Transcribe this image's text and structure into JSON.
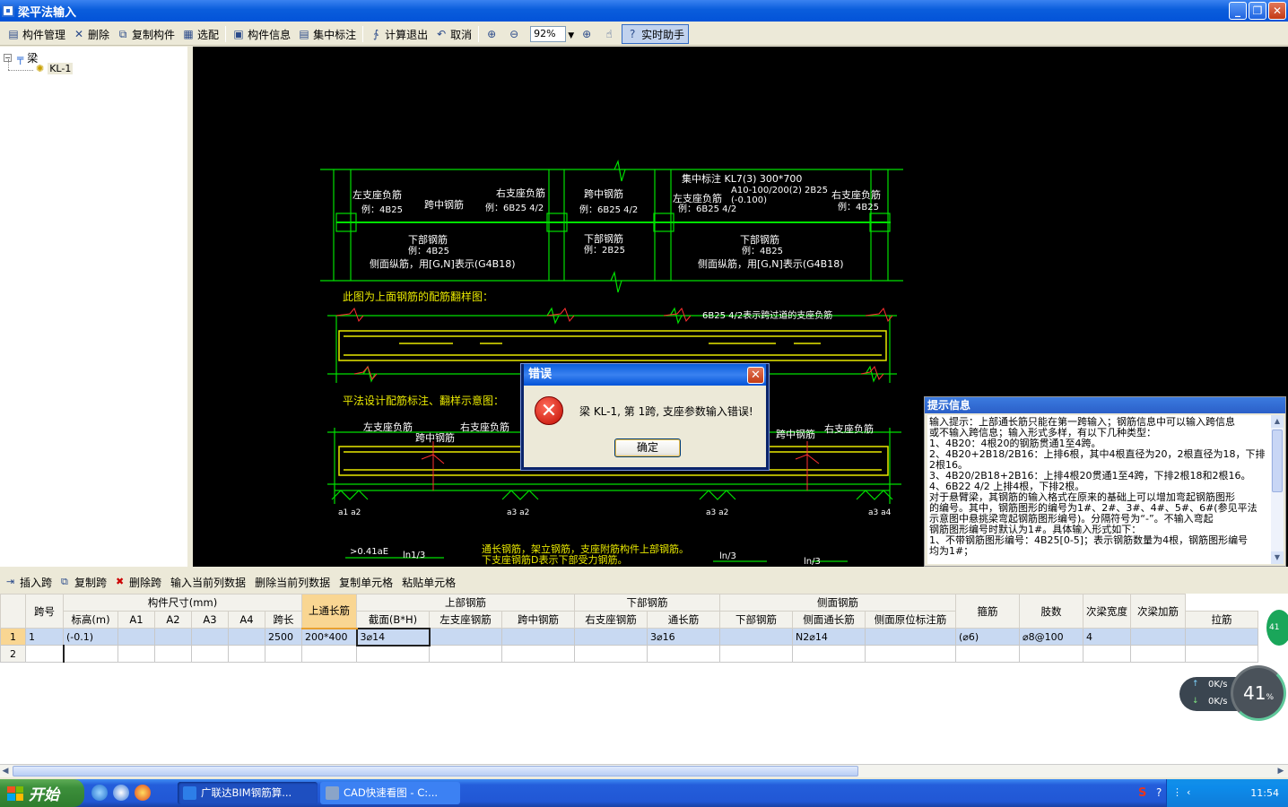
{
  "window": {
    "title": "梁平法输入"
  },
  "toolbar": {
    "items": [
      "构件管理",
      "删除",
      "复制构件",
      "选配",
      "构件信息",
      "集中标注",
      "计算退出",
      "取消"
    ],
    "zoom": "92%",
    "assistant": "实时助手"
  },
  "tree": {
    "root": "梁",
    "child": "KL-1"
  },
  "drawing": {
    "jz_title": "集中标注 KL7(3) 300*700",
    "jz_line2": "A10-100/200(2) 2B25",
    "jz_line3": "(-0.100)",
    "zuo_fu": "左支座负筋",
    "zuo_fu_eg": "例：4B25",
    "kua_zhong": "跨中钢筋",
    "you_fu": "右支座负筋",
    "you_fu_eg": "例：6B25 4/2",
    "kua_zhong2": "跨中钢筋",
    "kz_eg": "例：6B25 4/2",
    "zuo_fu2": "左支座负筋",
    "zuo_fu2_eg": "例：6B25 4/2",
    "you_fu2": "右支座负筋",
    "you_fu2_eg": "例：4B25",
    "xia1": "下部钢筋",
    "xia1_eg": "例：4B25",
    "xia2": "下部钢筋",
    "xia2_eg": "例：2B25",
    "xia3": "下部钢筋",
    "xia3_eg": "例：4B25",
    "cemian1": "侧面纵筋，用[G,N]表示(G4B18)",
    "cemian2": "侧面纵筋，用[G,N]表示(G4B18)",
    "caption1": "此图为上面钢筋的配筋翻样图：",
    "note_6b25": "6B25 4/2表示跨过道的支座负筋",
    "caption2": "平法设计配筋标注、翻样示意图：",
    "b_zuo": "左支座负筋",
    "b_you": "右支座负筋",
    "b_kz": "跨中钢筋",
    "b_kz2": "跨中钢筋",
    "b_you2": "右支座负筋",
    "a1a2": "a1  a2",
    "a3a2": "a3  a2",
    "a3a2b": "a3  a2",
    "a3a4": "a3  a4",
    "len1": ">0.41aE",
    "ln13": "ln1/3",
    "ln3": "ln/3",
    "ln3b": "ln/3",
    "foot1": "通长钢筋，架立钢筋，支座附筋构件上部钢筋。",
    "foot2": "下支座钢筋D表示下部受力钢筋。"
  },
  "tips": {
    "title": "提示信息",
    "lines": [
      "输入提示：上部通长筋只能在第一跨输入；钢筋信息中可以输入跨信息",
      "或不输入跨信息；输入形式多样，有以下几种类型：",
      "1、4B20：4根20的钢筋贯通1至4跨。",
      "2、4B20+2B18/2B16：上排6根，其中4根直径为20，2根直径为18，下排",
      "2根16。",
      "3、4B20/2B18+2B16：上排4根20贯通1至4跨，下排2根18和2根16。",
      "4、6B22 4/2 上排4根，下排2根。",
      "对于悬臂梁，其钢筋的输入格式在原来的基础上可以增加弯起钢筋图形",
      "的编号。其中，钢筋图形的编号为1#、2#、3#、4#、5#、6#(参见平法",
      "示意图中悬挑梁弯起钢筋图形编号)。分隔符号为“-”。不输入弯起",
      "钢筋图形编号时默认为1#。具体输入形式如下：",
      "1、不带钢筋图形编号：4B25[0-5]；表示钢筋数量为4根，钢筋图形编号",
      "均为1#；"
    ]
  },
  "dialog": {
    "title": "错误",
    "message": "梁 KL-1, 第 1跨, 支座参数输入错误!",
    "ok": "确定"
  },
  "gridbar": {
    "items": [
      "插入跨",
      "复制跨",
      "删除跨",
      "输入当前列数据",
      "删除当前列数据",
      "复制单元格",
      "粘贴单元格"
    ]
  },
  "grid": {
    "groups": {
      "dims": "构件尺寸(mm)",
      "top": "上部钢筋",
      "bottom": "下部钢筋",
      "side": "侧面钢筋"
    },
    "headers": {
      "span": "跨号",
      "elev": "标高(m)",
      "a1": "A1",
      "a2": "A2",
      "a3": "A3",
      "a4": "A4",
      "len": "跨长",
      "sec": "截面(B*H)",
      "through": "上通长筋",
      "left": "左支座钢筋",
      "mid": "跨中钢筋",
      "right": "右支座钢筋",
      "b_through": "通长筋",
      "b_bot": "下部钢筋",
      "s_through": "侧面通长筋",
      "s_orig": "侧面原位标注筋",
      "tie": "拉筋",
      "stirrup": "箍筋",
      "legs": "肢数",
      "sec_w": "次梁宽度",
      "sec_add": "次梁加筋"
    },
    "rows": [
      {
        "num": "1",
        "span": "1",
        "elev": "(-0.1)",
        "len": "2500",
        "sec": "200*400",
        "through": "3⌀14",
        "b_through": "3⌀16",
        "s_through": "N2⌀14",
        "tie": "(⌀6)",
        "stirrup": "⌀8@100",
        "legs": "4"
      },
      {
        "num": "2",
        "span": "",
        "elev": "",
        "len": "",
        "sec": "",
        "through": "",
        "b_through": "",
        "s_through": "",
        "tie": "",
        "stirrup": "",
        "legs": ""
      }
    ]
  },
  "taskbar": {
    "start": "开始",
    "task1": "广联达BIM钢筋算...",
    "task2": "CAD快速看图 - C:...",
    "clock": "11:54"
  },
  "widget": {
    "up": "0K/s",
    "down": "0K/s",
    "percent": "41",
    "percent_sign": "%",
    "ball": "41"
  }
}
